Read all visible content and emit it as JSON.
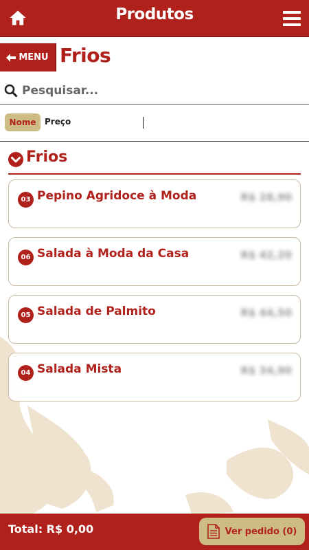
{
  "header": {
    "title": "Produtos",
    "home_icon": "home-icon",
    "menu_icon": "hamburger-icon"
  },
  "nav": {
    "back_label": "MENU",
    "page_title": "Frios"
  },
  "search": {
    "placeholder": "Pesquisar...",
    "value": ""
  },
  "sort": {
    "name_label": "Nome",
    "price_label": "Preço",
    "active": "Nome"
  },
  "section": {
    "title": "Frios"
  },
  "products": [
    {
      "number": "03",
      "name": "Pepino Agridoce à Moda",
      "price": "R$ 28,90"
    },
    {
      "number": "06",
      "name": "Salada à Moda da Casa",
      "price": "R$ 42,20"
    },
    {
      "number": "05",
      "name": "Salada de Palmito",
      "price": "R$ 44,50"
    },
    {
      "number": "04",
      "name": "Salada Mista",
      "price": "R$ 34,90"
    }
  ],
  "footer": {
    "total_label": "Total: R$ 0,00",
    "order_button": "Ver pedido (0)"
  },
  "colors": {
    "brand_red": "#b0211c",
    "accent_gold": "#cdbd85"
  }
}
